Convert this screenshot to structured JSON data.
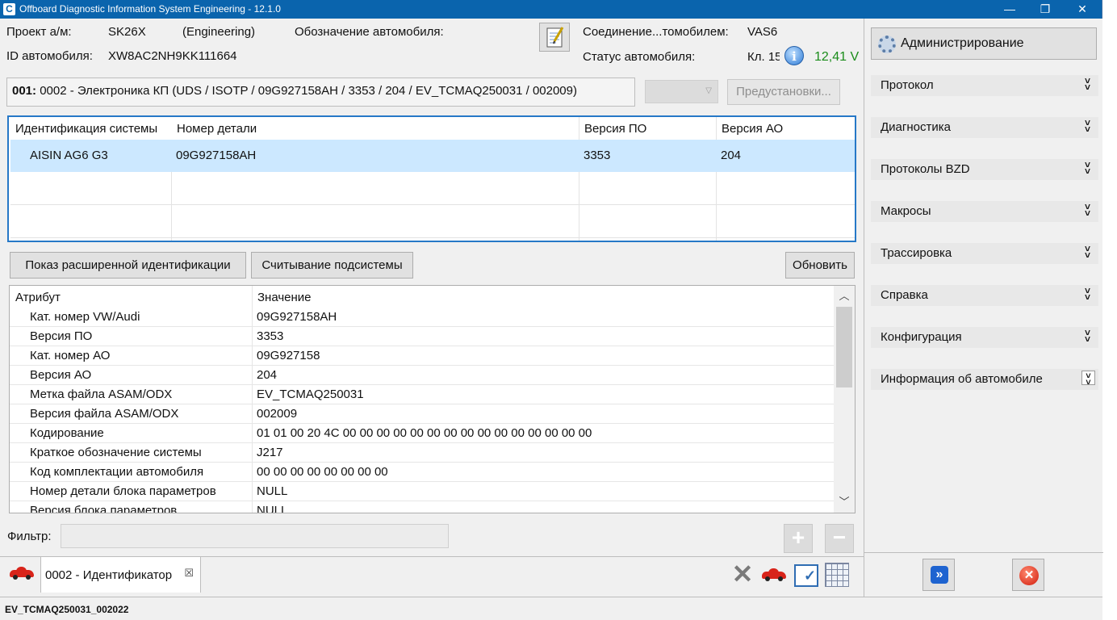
{
  "window": {
    "title": "Offboard Diagnostic Information System Engineering - 12.1.0",
    "minimize": "—",
    "maximize": "❐",
    "close": "✕"
  },
  "header": {
    "project_label": "Проект а/м:",
    "project_value": "SK26X",
    "project_mode": "(Engineering)",
    "vehicle_designation_label": "Обозначение автомобиля:",
    "connection_label": "Соединение...томобилем:",
    "connection_value": "VAS6",
    "vin_label": "ID автомобиля:",
    "vin_value": "XW8AC2NH9KK111664",
    "vehicle_status_label": "Статус автомобиля:",
    "terminal_value": "Кл. 15",
    "voltage": "12,41 V",
    "voltage_color": "#1a8c1a"
  },
  "sidebar": {
    "admin_label": "Администрирование",
    "items": [
      {
        "label": "Протокол"
      },
      {
        "label": "Диагностика"
      },
      {
        "label": "Протоколы BZD"
      },
      {
        "label": "Макросы"
      },
      {
        "label": "Трассировка"
      },
      {
        "label": "Справка"
      },
      {
        "label": "Конфигурация"
      },
      {
        "label": "Информация об автомобиле"
      }
    ],
    "chevron": "˅\n˅"
  },
  "selector": {
    "id": "001:",
    "text": "0002 - Электроника КП  (UDS / ISOTP / 09G927158AH / 3353 / 204 / EV_TCMAQ250031 / 002009)",
    "combo_value": "",
    "presets_label": "Предустановки..."
  },
  "system_table": {
    "headers": [
      "Идентификация системы",
      "Номер детали",
      "Версия ПО",
      "Версия АО"
    ],
    "rows": [
      [
        "AISIN AG6 G3",
        "09G927158AH",
        "3353",
        "204"
      ]
    ]
  },
  "actions": {
    "extended_id_label": "Показ расширенной идентификации",
    "subsystem_label": "Считывание подсистемы",
    "refresh_label": "Обновить"
  },
  "attr_table": {
    "headers": [
      "Атрибут",
      "Значение"
    ],
    "rows": [
      [
        "Кат. номер VW/Audi",
        "09G927158AH"
      ],
      [
        "Версия ПО",
        "3353"
      ],
      [
        "Кат. номер АО",
        "09G927158"
      ],
      [
        "Версия АО",
        "204"
      ],
      [
        "Метка файла ASAM/ODX",
        "EV_TCMAQ250031"
      ],
      [
        "Версия файла ASAM/ODX",
        "002009"
      ],
      [
        "Кодирование",
        "01 01 00 20 4C 00 00 00 00 00 00 00 00 00 00 00 00 00 00 00"
      ],
      [
        "Краткое обозначение системы",
        "J217"
      ],
      [
        "Код комплектации автомобиля",
        "00 00 00 00 00 00 00 00"
      ],
      [
        "Номер детали блока параметров",
        "NULL"
      ],
      [
        "Версия блока параметров",
        "NULL"
      ]
    ]
  },
  "filter": {
    "label": "Фильтр:",
    "value": "",
    "plus": "+",
    "minus": "−"
  },
  "tabs": {
    "active_label": "0002 - Идентификатор",
    "close_glyph": "☒"
  },
  "statusbar": {
    "text": "EV_TCMAQ250031_002022"
  }
}
